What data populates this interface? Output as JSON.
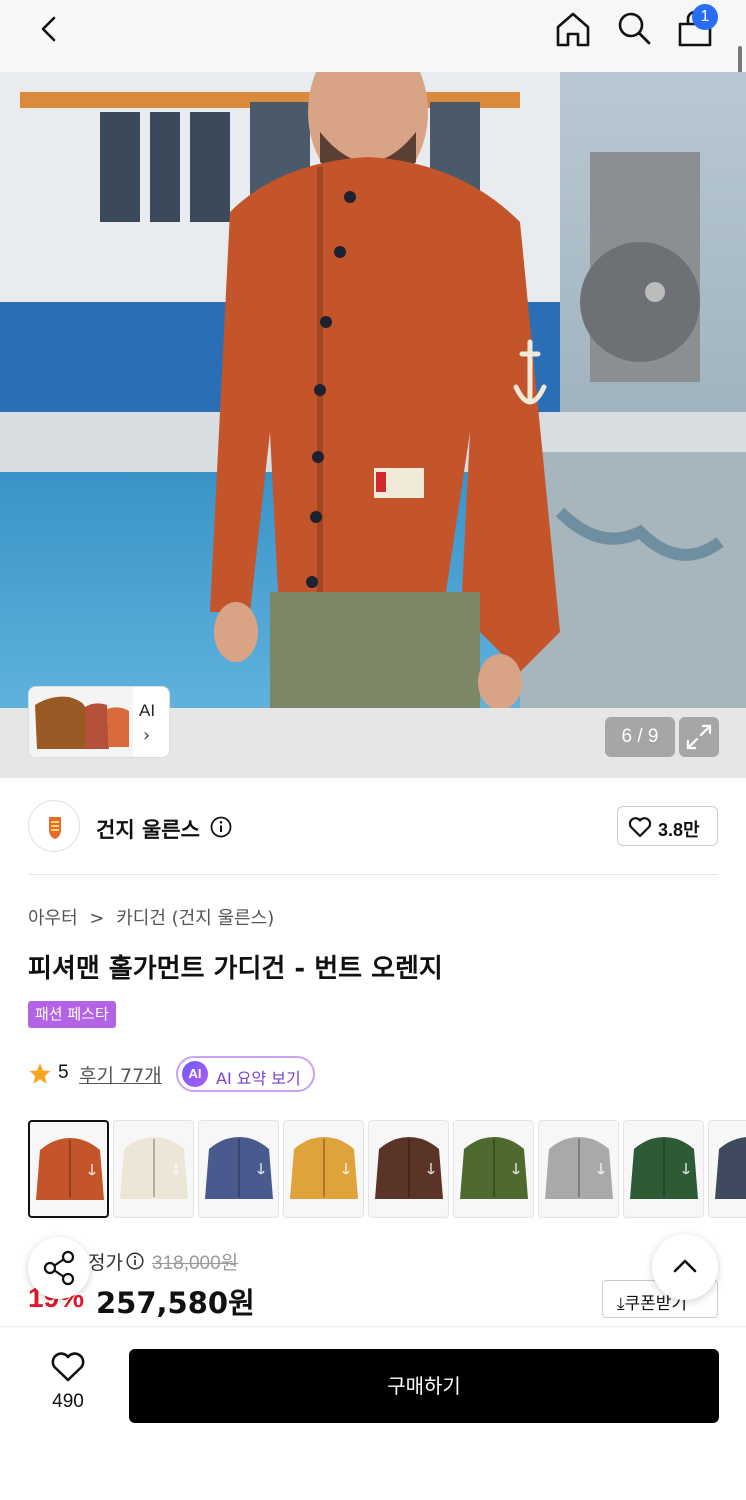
{
  "header": {
    "cart_count": "1",
    "icons": [
      "back-arrow-icon",
      "home-icon",
      "search-icon",
      "cart-icon"
    ]
  },
  "gallery": {
    "counter": "6 / 9",
    "ai_label": "AI",
    "ai_chevron": "›"
  },
  "brand": {
    "name": "건지 울른스",
    "likes": "3.8만"
  },
  "product": {
    "breadcrumb": [
      "아우터",
      "카디건 (건지 울른스)"
    ],
    "breadcrumb_sep": ">",
    "title": "피셔맨 홀가먼트 가디건 - 번트 오렌지",
    "tag": "패션 페스타",
    "rating": "5",
    "reviews": "후기 77개",
    "ai_summary_badge": "AI",
    "ai_summary": "AI 요약 보기"
  },
  "colors": {
    "swatches": [
      "#c4542a",
      "#ece6d6",
      "#4a5a8e",
      "#e0a23a",
      "#5a3426",
      "#4f6a2e",
      "#a9a9a9",
      "#2e5a36",
      "#3f4a5e"
    ],
    "selected_index": 0
  },
  "price": {
    "label": "정가",
    "original": "318,000원",
    "discount": "19%",
    "sale": "257,580원",
    "coupon": "쿠폰받기"
  },
  "bottom": {
    "wish_count": "490",
    "buy_label": "구매하기"
  },
  "colors_theme": {
    "accent_badge": "#2a6df5",
    "tag_bg": "#b364e6",
    "discount": "#e0192d"
  }
}
